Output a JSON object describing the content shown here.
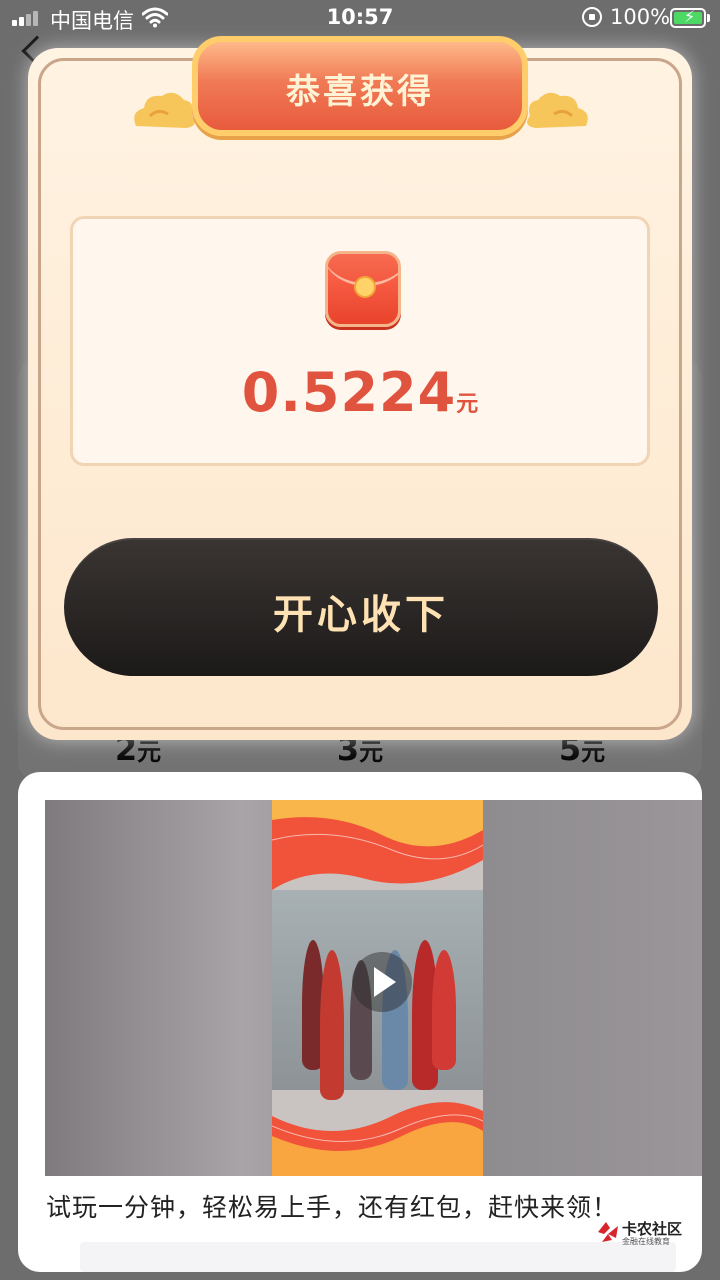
{
  "status_bar": {
    "carrier": "中国电信",
    "time": "10:57",
    "battery": "100%"
  },
  "background": {
    "prices": [
      {
        "value": "2",
        "unit": "元"
      },
      {
        "value": "3",
        "unit": "元"
      },
      {
        "value": "5",
        "unit": "元"
      }
    ]
  },
  "popup": {
    "title": "恭喜获得",
    "amount": "0.5224",
    "unit": "元",
    "accept_label": "开心收下"
  },
  "ad": {
    "caption": "试玩一分钟，轻松易上手，还有红包，赶快来领！",
    "watermark_title": "卡农社区",
    "watermark_subtitle": "金融在线教育"
  },
  "colors": {
    "accent_red": "#e0533f",
    "button_dark": "#1c1a19",
    "button_text": "#ffe2b3",
    "popup_bg": "#fff3e2"
  }
}
